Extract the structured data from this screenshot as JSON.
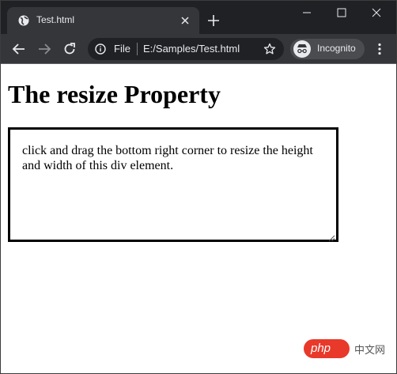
{
  "tab": {
    "title": "Test.html"
  },
  "address_bar": {
    "scheme_label": "File",
    "url": "E:/Samples/Test.html"
  },
  "profile": {
    "label": "Incognito"
  },
  "page": {
    "heading": "The resize Property",
    "box_text": "click and drag the bottom right corner to resize the height and width of this div element."
  },
  "watermark": {
    "brand": "php",
    "site": "中文网"
  },
  "colors": {
    "titlebar": "#202124",
    "toolbar": "#35363a",
    "brand_red": "#e8392a"
  }
}
